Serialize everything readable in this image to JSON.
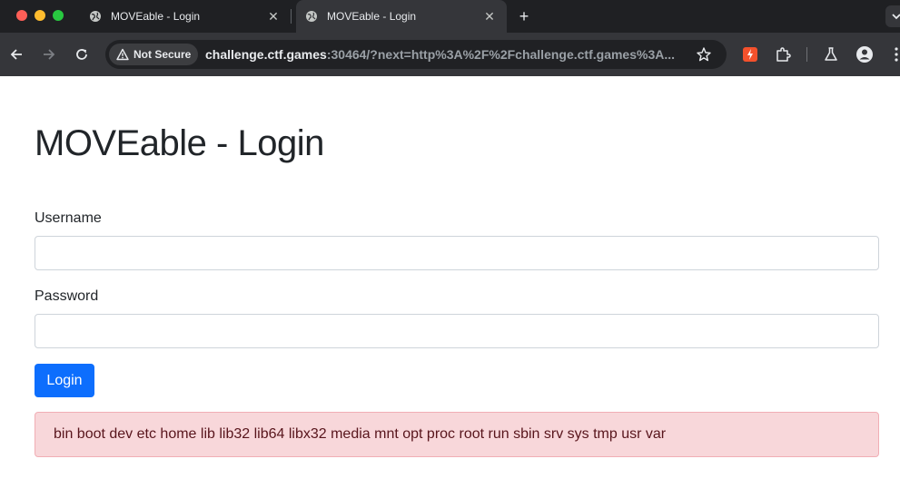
{
  "browser": {
    "tabs": [
      {
        "title": "MOVEable - Login",
        "icon": "globe-icon",
        "active": false
      },
      {
        "title": "MOVEable - Login",
        "icon": "globe-icon",
        "active": true
      }
    ],
    "security_label": "Not Secure",
    "url_host": "challenge.ctf.games",
    "url_rest": ":30464/?next=http%3A%2F%2Fchallenge.ctf.games%3A..."
  },
  "page": {
    "title": "MOVEable - Login",
    "username_label": "Username",
    "username_value": "",
    "password_label": "Password",
    "password_value": "",
    "login_button": "Login",
    "alert_text": "bin boot dev etc home lib lib32 lib64 libx32 media mnt opt proc root run sbin srv sys tmp usr var"
  },
  "colors": {
    "chrome_dark": "#1f2023",
    "chrome_toolbar": "#35363a",
    "primary": "#0d6efd",
    "alert_bg": "#f8d7da",
    "alert_text": "#58151c"
  }
}
